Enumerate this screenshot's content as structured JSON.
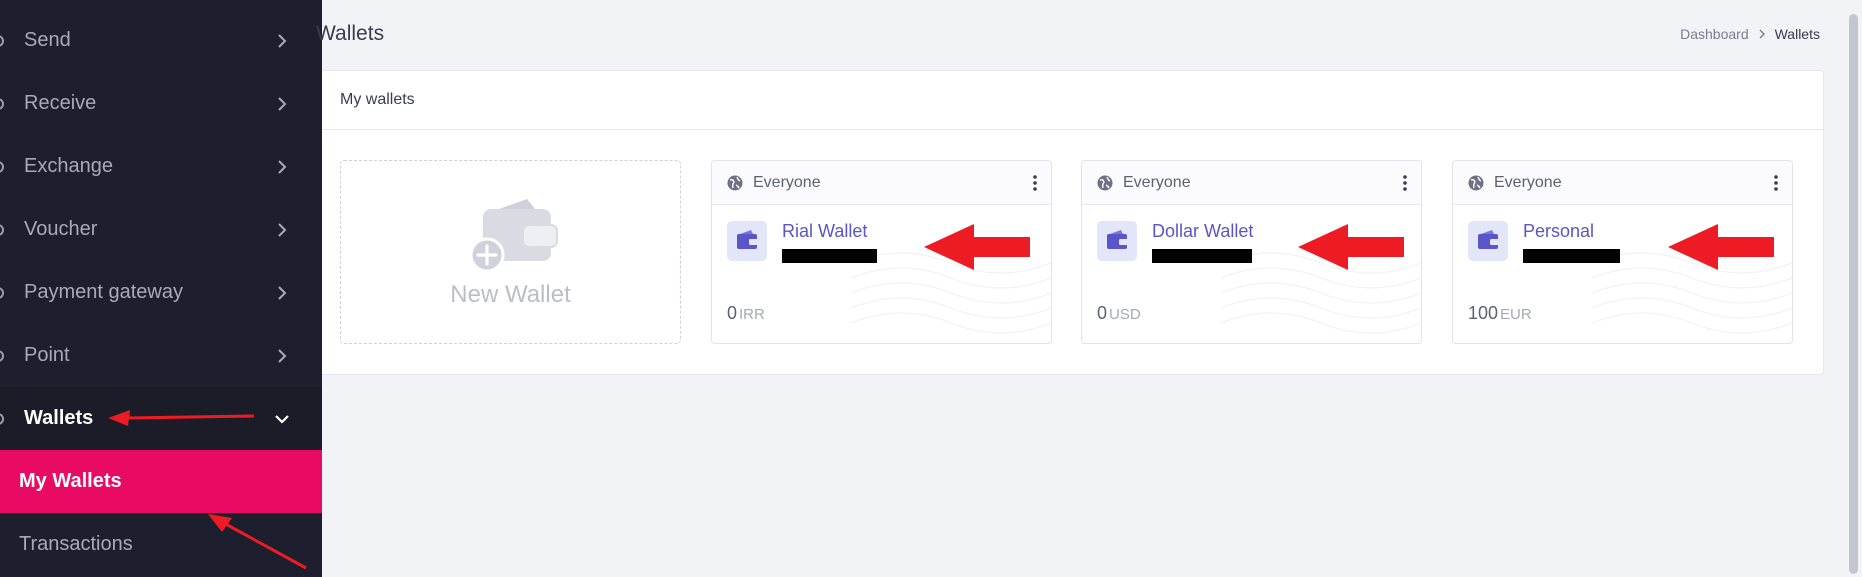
{
  "sidebar": {
    "items": [
      {
        "label": "Send"
      },
      {
        "label": "Receive"
      },
      {
        "label": "Exchange"
      },
      {
        "label": "Voucher"
      },
      {
        "label": "Payment gateway"
      },
      {
        "label": "Point"
      },
      {
        "label": "Wallets"
      }
    ],
    "subitems": [
      {
        "label": "My Wallets"
      },
      {
        "label": "Transactions"
      }
    ]
  },
  "header": {
    "title": "Wallets",
    "breadcrumb": [
      "Dashboard",
      "Wallets"
    ]
  },
  "panel": {
    "title": "My wallets",
    "new_wallet_label": "New Wallet",
    "wallets": [
      {
        "visibility": "Everyone",
        "name": "Rial Wallet",
        "balance": "0",
        "currency": "IRR"
      },
      {
        "visibility": "Everyone",
        "name": "Dollar Wallet",
        "balance": "0",
        "currency": "USD"
      },
      {
        "visibility": "Everyone",
        "name": "Personal",
        "balance": "100",
        "currency": "EUR"
      }
    ]
  },
  "colors": {
    "sidebar_bg": "#1e1f2e",
    "active_submenu": "#e90b63",
    "wallet_name": "#5a55c9",
    "annotation_arrow": "#ed1c24"
  },
  "icons": [
    "chevron-right-icon",
    "chevron-down-icon",
    "globe-icon",
    "more-vertical-icon",
    "wallet-icon",
    "wallet-add-icon"
  ]
}
